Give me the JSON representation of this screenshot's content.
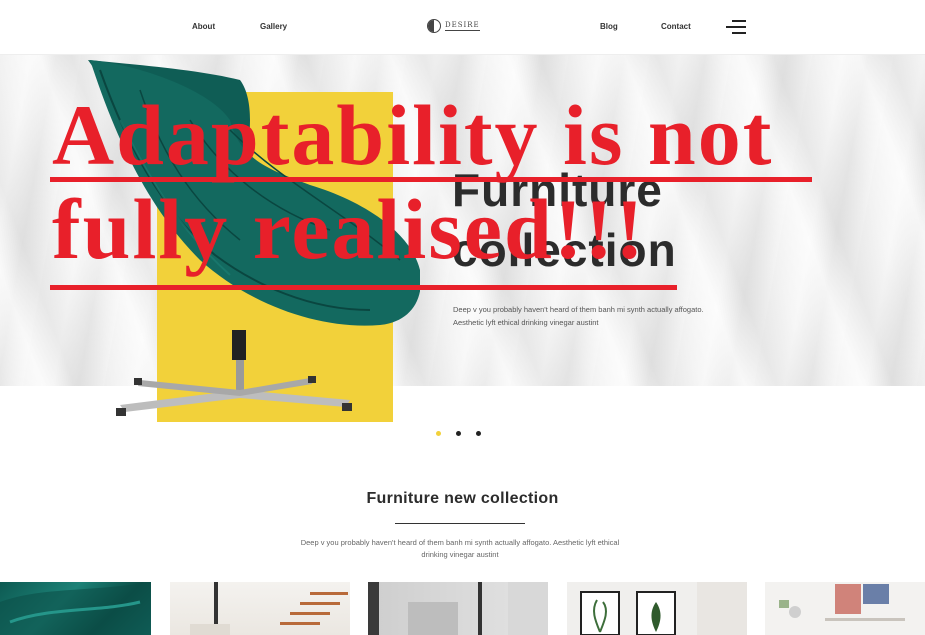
{
  "header": {
    "nav_left": [
      "About",
      "Gallery"
    ],
    "logo_text": "DESIRE",
    "nav_right": [
      "Blog",
      "Contact"
    ],
    "menu_icon": "hamburger-menu-icon"
  },
  "hero": {
    "title_line1": "Furniture",
    "title_line2": "collection",
    "description_line1": "Deep v you probably haven't heard of them banh mi synth actually affogato.",
    "description_line2": "Aesthetic lyft ethical drinking vinegar austint",
    "accent_color": "#f2d13a"
  },
  "overlay": {
    "line1": "Adaptability is not",
    "line2": "fully realised!!!",
    "color": "#e8202a"
  },
  "slider": {
    "dots": 3,
    "active_index": 0
  },
  "section": {
    "title": "Furniture new collection",
    "description_line1": "Deep v you probably haven't heard of them banh mi synth actually affogato. Aesthetic lyft ethical",
    "description_line2": "drinking vinegar austint"
  },
  "thumbnails": [
    "green-armchair-thumbnail",
    "staircase-interior-thumbnail",
    "dark-doorway-thumbnail",
    "framed-plants-thumbnail",
    "shelf-decor-thumbnail"
  ]
}
